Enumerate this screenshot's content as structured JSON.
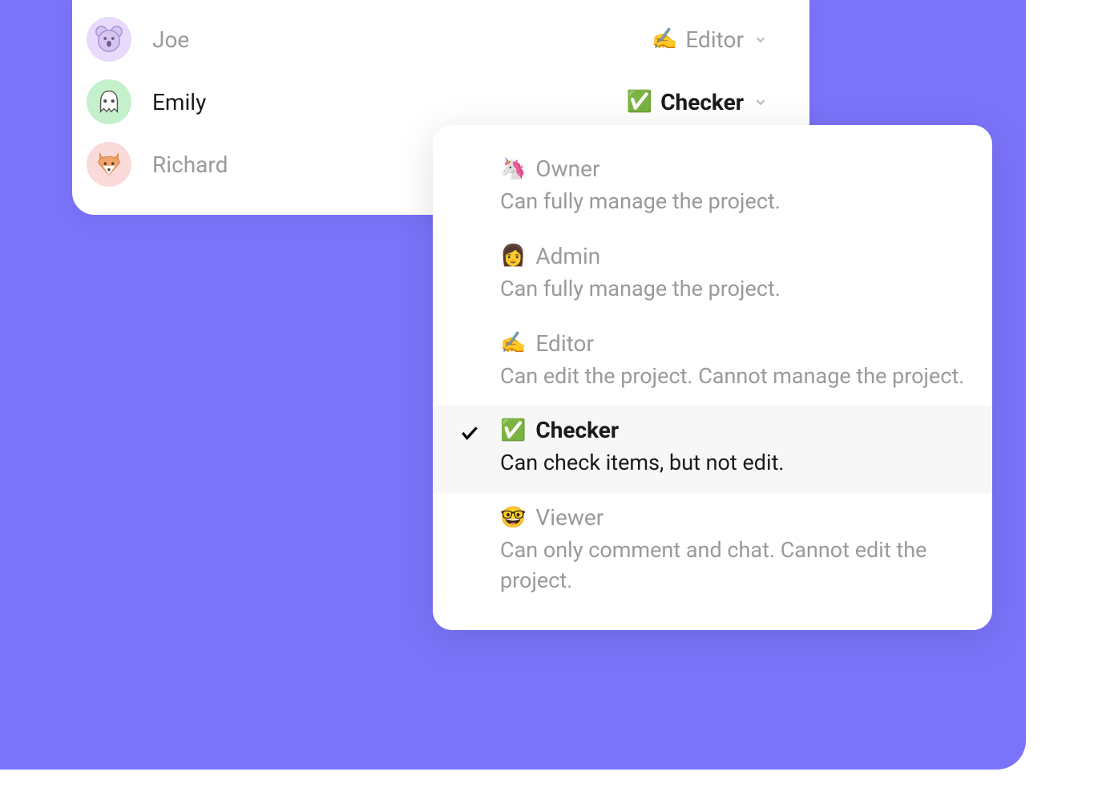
{
  "members": [
    {
      "name": "Joe",
      "avatar_color": "purple",
      "avatar_kind": "koala",
      "role_emoji": "✍️",
      "role_label": "Editor",
      "selected": false,
      "muted": true
    },
    {
      "name": "Emily",
      "avatar_color": "green",
      "avatar_kind": "ghost",
      "role_emoji": "✅",
      "role_label": "Checker",
      "selected": true,
      "muted": false
    },
    {
      "name": "Richard",
      "avatar_color": "pink",
      "avatar_kind": "fox",
      "role_emoji": "",
      "role_label": "",
      "selected": false,
      "muted": true
    }
  ],
  "role_options": [
    {
      "emoji": "🦄",
      "title": "Owner",
      "desc": "Can fully manage the project.",
      "selected": false
    },
    {
      "emoji": "👩",
      "title": "Admin",
      "desc": "Can fully manage the project.",
      "selected": false
    },
    {
      "emoji": "✍️",
      "title": "Editor",
      "desc": "Can edit the project. Cannot manage the project.",
      "selected": false
    },
    {
      "emoji": "✅",
      "title": "Checker",
      "desc": "Can check items, but not edit.",
      "selected": true
    },
    {
      "emoji": "🤓",
      "title": "Viewer",
      "desc": "Can only comment and chat. Cannot edit the project.",
      "selected": false
    }
  ]
}
